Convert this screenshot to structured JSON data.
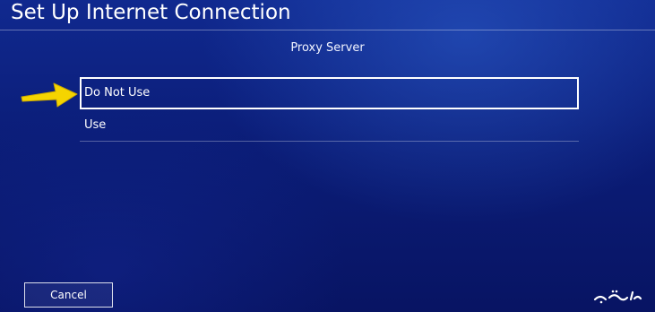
{
  "header": {
    "title": "Set Up Internet Connection"
  },
  "main": {
    "section_title": "Proxy Server",
    "options": [
      {
        "label": "Do Not Use",
        "selected": true
      },
      {
        "label": "Use",
        "selected": false
      }
    ]
  },
  "footer": {
    "cancel_label": "Cancel"
  },
  "watermark": {
    "text": "گیفت برگ"
  },
  "colors": {
    "background": "#0b1d78",
    "highlight_border": "#ffffff",
    "arrow": "#f5d400"
  },
  "icons": {
    "pointer": "arrow-right-icon"
  }
}
